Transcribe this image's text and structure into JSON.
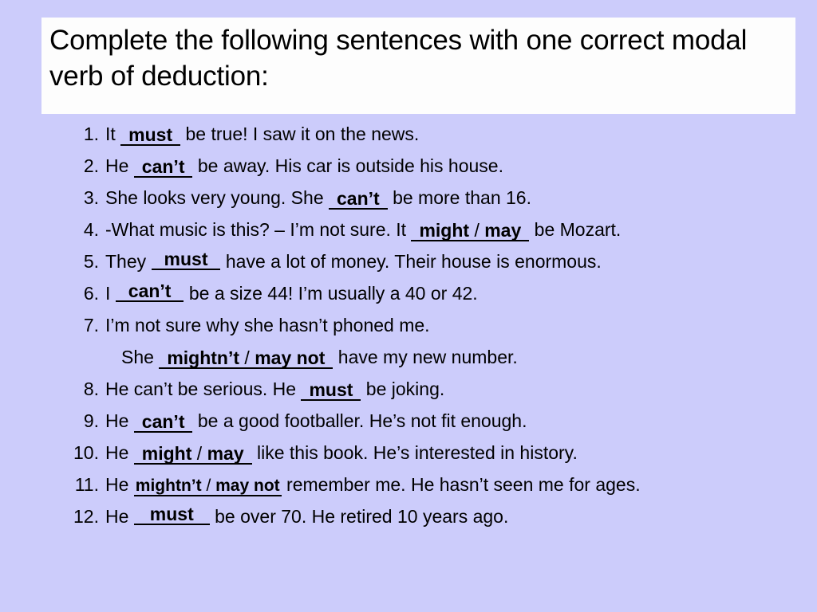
{
  "slide": {
    "background_color": "#ccccfb",
    "title_background_color": "#fdfdfd",
    "text_color": "#000000",
    "title": "Complete the following sentences with one correct modal verb of deduction:"
  },
  "exercises": [
    {
      "number": "1.",
      "before": "It ",
      "answer": "must",
      "after": " be true! I saw it on the news.",
      "style": "pad-wide"
    },
    {
      "number": "2.",
      "before": "He ",
      "answer": "can’t",
      "after": " be away. His car is outside his house.",
      "style": "pad-wide"
    },
    {
      "number": "3.",
      "before": "She looks very young. She ",
      "answer": "can’t",
      "after": " be more than 16.",
      "style": "pad-wide"
    },
    {
      "number": "4.",
      "before": "-What music is this? – I’m not sure. It ",
      "answer": "might",
      "answer_slash": " / ",
      "answer2": "may",
      "after": " be Mozart.",
      "style": "pad-wide"
    },
    {
      "number": "5.",
      "before": "They ",
      "answer": "must",
      "after": " have a lot of money. Their house is enormous.",
      "style": "raised"
    },
    {
      "number": "6.",
      "before": "I ",
      "answer": "can’t",
      "after": " be a size 44! I’m usually a 40 or 42.",
      "style": "raised"
    },
    {
      "number": "7.",
      "before": "I’m not sure why she hasn’t phoned me.",
      "answer": "",
      "after": "",
      "style": "none"
    },
    {
      "number": "",
      "continuation": true,
      "before": "She ",
      "answer": "mightn’t",
      "answer_slash": " / ",
      "answer2": "may not",
      "after": " have my new number.",
      "style": "pad-wide"
    },
    {
      "number": "8.",
      "before": "He can’t be serious. He ",
      "answer": "must",
      "after": " be joking.",
      "style": "pad-wide"
    },
    {
      "number": "9.",
      "before": "He ",
      "answer": "can’t",
      "after": " be a good footballer. He’s not fit enough.",
      "style": "pad-wide"
    },
    {
      "number": "10.",
      "before": "He ",
      "answer": "might",
      "answer_slash": " / ",
      "answer2": "may",
      "after": " like this book. He’s interested in history.",
      "style": "pad-wide"
    },
    {
      "number": "11.",
      "before": "He ",
      "answer": "mightn’t",
      "answer_slash": " / ",
      "answer2": "may not",
      "after": " remember me. He hasn’t seen me for ages.",
      "style": "tight"
    },
    {
      "number": "12.",
      "before": "He ",
      "answer": "must",
      "after": " be over 70. He retired 10 years ago.",
      "style": "raised-sm"
    }
  ]
}
